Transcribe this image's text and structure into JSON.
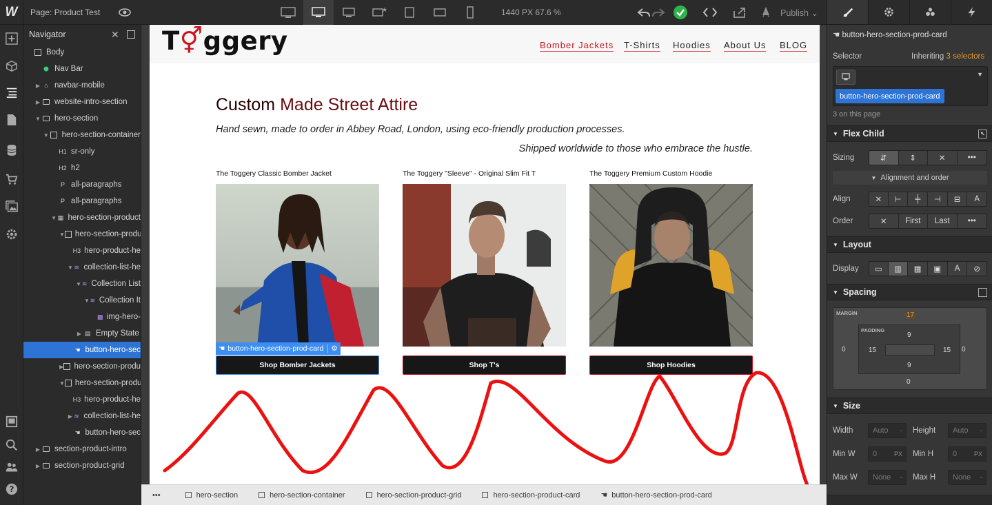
{
  "topbar": {
    "page_label": "Page:",
    "page_name": "Product Test",
    "zoom": "1440 PX  67.6 %",
    "publish_label": "Publish"
  },
  "navigator": {
    "title": "Navigator",
    "rows": [
      {
        "label": "Body",
        "indent": 0,
        "caret": "",
        "icon": "box"
      },
      {
        "label": "Nav Bar",
        "indent": 1,
        "caret": "",
        "icon": "component"
      },
      {
        "label": "navbar-mobile",
        "indent": 1,
        "caret": "right",
        "icon": "home"
      },
      {
        "label": "website-intro-section",
        "indent": 1,
        "caret": "right",
        "icon": "section"
      },
      {
        "label": "hero-section",
        "indent": 1,
        "caret": "down",
        "icon": "section"
      },
      {
        "label": "hero-section-container",
        "indent": 2,
        "caret": "down",
        "icon": "box"
      },
      {
        "label": "sr-only",
        "indent": 3,
        "caret": "",
        "icon": "H1"
      },
      {
        "label": "h2",
        "indent": 3,
        "caret": "",
        "icon": "H2"
      },
      {
        "label": "all-paragraphs",
        "indent": 3,
        "caret": "",
        "icon": "P"
      },
      {
        "label": "all-paragraphs",
        "indent": 3,
        "caret": "",
        "icon": "P"
      },
      {
        "label": "hero-section-product",
        "indent": 3,
        "caret": "down",
        "icon": "grid"
      },
      {
        "label": "hero-section-produ",
        "indent": 4,
        "caret": "down",
        "icon": "box"
      },
      {
        "label": "hero-product-he",
        "indent": 5,
        "caret": "",
        "icon": "H3"
      },
      {
        "label": "collection-list-he",
        "indent": 5,
        "caret": "down",
        "icon": "db"
      },
      {
        "label": "Collection List",
        "indent": 6,
        "caret": "down",
        "icon": "db"
      },
      {
        "label": "Collection It",
        "indent": 7,
        "caret": "down",
        "icon": "db"
      },
      {
        "label": "img-hero-",
        "indent": 8,
        "caret": "",
        "icon": "img"
      },
      {
        "label": "Empty State",
        "indent": 6,
        "caret": "right",
        "icon": "empty"
      },
      {
        "label": "button-hero-sec",
        "indent": 5,
        "caret": "",
        "icon": "hand",
        "selected": true
      },
      {
        "label": "hero-section-produ",
        "indent": 4,
        "caret": "right",
        "icon": "box"
      },
      {
        "label": "hero-section-produ",
        "indent": 4,
        "caret": "down",
        "icon": "box"
      },
      {
        "label": "hero-product-he",
        "indent": 5,
        "caret": "",
        "icon": "H3"
      },
      {
        "label": "collection-list-he",
        "indent": 5,
        "caret": "right",
        "icon": "db"
      },
      {
        "label": "button-hero-sec",
        "indent": 5,
        "caret": "",
        "icon": "hand"
      },
      {
        "label": "section-product-intro",
        "indent": 1,
        "caret": "right",
        "icon": "section"
      },
      {
        "label": "section-product-grid",
        "indent": 1,
        "caret": "right",
        "icon": "section"
      }
    ]
  },
  "site": {
    "brand": "Toggery",
    "menu": [
      "Bomber Jackets",
      "T-Shirts",
      "Hoodies",
      "About Us",
      "BLOG"
    ],
    "heading_part1": "Custom ",
    "heading_part2": "Made Street Attire",
    "paragraph1": "Hand sewn, made to order in Abbey Road, London, using eco-friendly production processes.",
    "paragraph2": "Shipped worldwide to those who embrace the hustle.",
    "cards": [
      {
        "title": "The Toggery Classic Bomber Jacket",
        "button": "Shop Bomber Jackets"
      },
      {
        "title": "The Toggery \"Sleeve\" - Original Slim Fit T",
        "button": "Shop T's"
      },
      {
        "title": "The Toggery Premium Custom Hoodie",
        "button": "Shop Hoodies"
      }
    ],
    "selected_tag": "button-hero-section-prod-card"
  },
  "breadcrumb": [
    "hero-section",
    "hero-section-container",
    "hero-section-product-grid",
    "hero-section-product-card",
    "button-hero-section-prod-card"
  ],
  "style_panel": {
    "element_name": "button-hero-section-prod-card",
    "selector_label": "Selector",
    "inheriting_label": "Inheriting",
    "inheriting_count": "3 selectors",
    "selector_chip": "button-hero-section-prod-card",
    "on_page": "3 on this page",
    "flex_child": "Flex Child",
    "sizing_label": "Sizing",
    "alignment_toggle": "Alignment and order",
    "align_label": "Align",
    "order_label": "Order",
    "order_first": "First",
    "order_last": "Last",
    "layout": "Layout",
    "display_label": "Display",
    "spacing": "Spacing",
    "margin_label": "MARGIN",
    "padding_label": "PADDING",
    "margin": {
      "top": "17",
      "right": "0",
      "bottom": "0",
      "left": "0"
    },
    "padding": {
      "top": "9",
      "right": "15",
      "bottom": "9",
      "left": "15"
    },
    "size": "Size",
    "width_label": "Width",
    "width_val": "Auto",
    "height_label": "Height",
    "height_val": "Auto",
    "minw_label": "Min W",
    "minw_val": "0",
    "minw_unit": "PX",
    "minh_label": "Min H",
    "minh_val": "0",
    "minh_unit": "PX",
    "maxw_label": "Max W",
    "maxw_val": "None",
    "maxh_label": "Max H",
    "maxh_val": "None"
  },
  "colors": {
    "accent": "#c9141f",
    "selection": "#2d74d6",
    "webflow_blue": "#3d8ef0"
  }
}
